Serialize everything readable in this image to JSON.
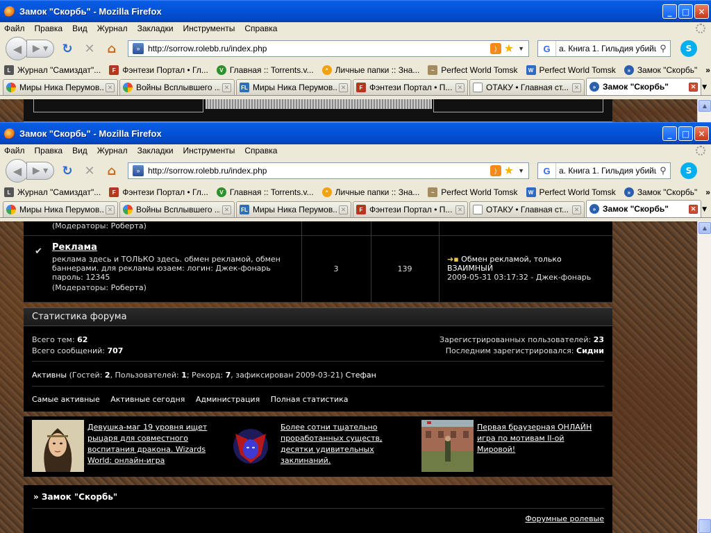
{
  "window": {
    "title": "Замок \"Скорбь\" - Mozilla Firefox",
    "min": "_",
    "max": "□",
    "close": "✕"
  },
  "menu": [
    "Файл",
    "Правка",
    "Вид",
    "Журнал",
    "Закладки",
    "Инструменты",
    "Справка"
  ],
  "nav": {
    "url": "http://sorrow.rolebb.ru/index.php",
    "search_text": "а. Книга 1. Гильдия убийц",
    "search_engine": "G",
    "skype": "S"
  },
  "bookmarks": [
    "Журнал \"Самиздат\"...",
    "Фэнтези Портал • Гл...",
    "Главная :: Torrents.v...",
    "Личные папки :: Зна...",
    "Perfect World Tomsk",
    "Perfect World Tomsk",
    "Замок \"Скорбь\""
  ],
  "bookmarks_more": "»",
  "tabs": [
    "Миры Ника Перумов...",
    "Войны Всплывшего ...",
    "Миры Ника Перумов...",
    "Фэнтези Портал • П...",
    "ОТАКУ • Главная ст...",
    "Замок \"Скорбь\""
  ],
  "forum": {
    "mods_label": "(Модераторы:",
    "mods_name": "Роберта",
    "mods_close": ")",
    "title": "Реклама",
    "desc": "реклама здесь и ТОЛЬКО здесь. обмен рекламой, обмен баннерами. для рекламы юзаем: логин: Джек-фонарь пароль: 12345",
    "topics": "3",
    "posts": "139",
    "last_post": "Обмен рекламой, только ВЗАИМНЫЙ",
    "last_meta": "2009-05-31 03:17:32 - Джек-фонарь"
  },
  "stats": {
    "header": "Статистика форума",
    "topics_label": "Всего тем:",
    "topics": "62",
    "posts_label": "Всего сообщений:",
    "posts": "707",
    "users_label": "Зарегистрированных пользователей:",
    "users": "23",
    "last_reg_label": "Последним зарегистрировался:",
    "last_reg": "Сидни",
    "active_label": "Активны",
    "active_text_1": "(Гостей:",
    "guests": "2",
    "active_text_2": ", Пользователей:",
    "users_online": "1",
    "active_text_3": "; Рекорд:",
    "record": "7",
    "active_text_4": ", зафиксирован 2009-03-21)",
    "active_user": "Стефан",
    "links": [
      "Самые активные",
      "Активные сегодня",
      "Администрация",
      "Полная статистика"
    ]
  },
  "ads": [
    "Девушка-маг 19 уровня ищет рыцаря для совместного воспитания дракона. Wizards World: онлайн-игра",
    "Более сотни тщательно проработанных существ, десятки удивительных заклинаний.",
    "Первая браузерная ОНЛАЙН игра по мотивам II-ой Мировой!"
  ],
  "footer": {
    "title": "» Замок \"Скорбь\"",
    "link": "Форумные ролевые"
  }
}
